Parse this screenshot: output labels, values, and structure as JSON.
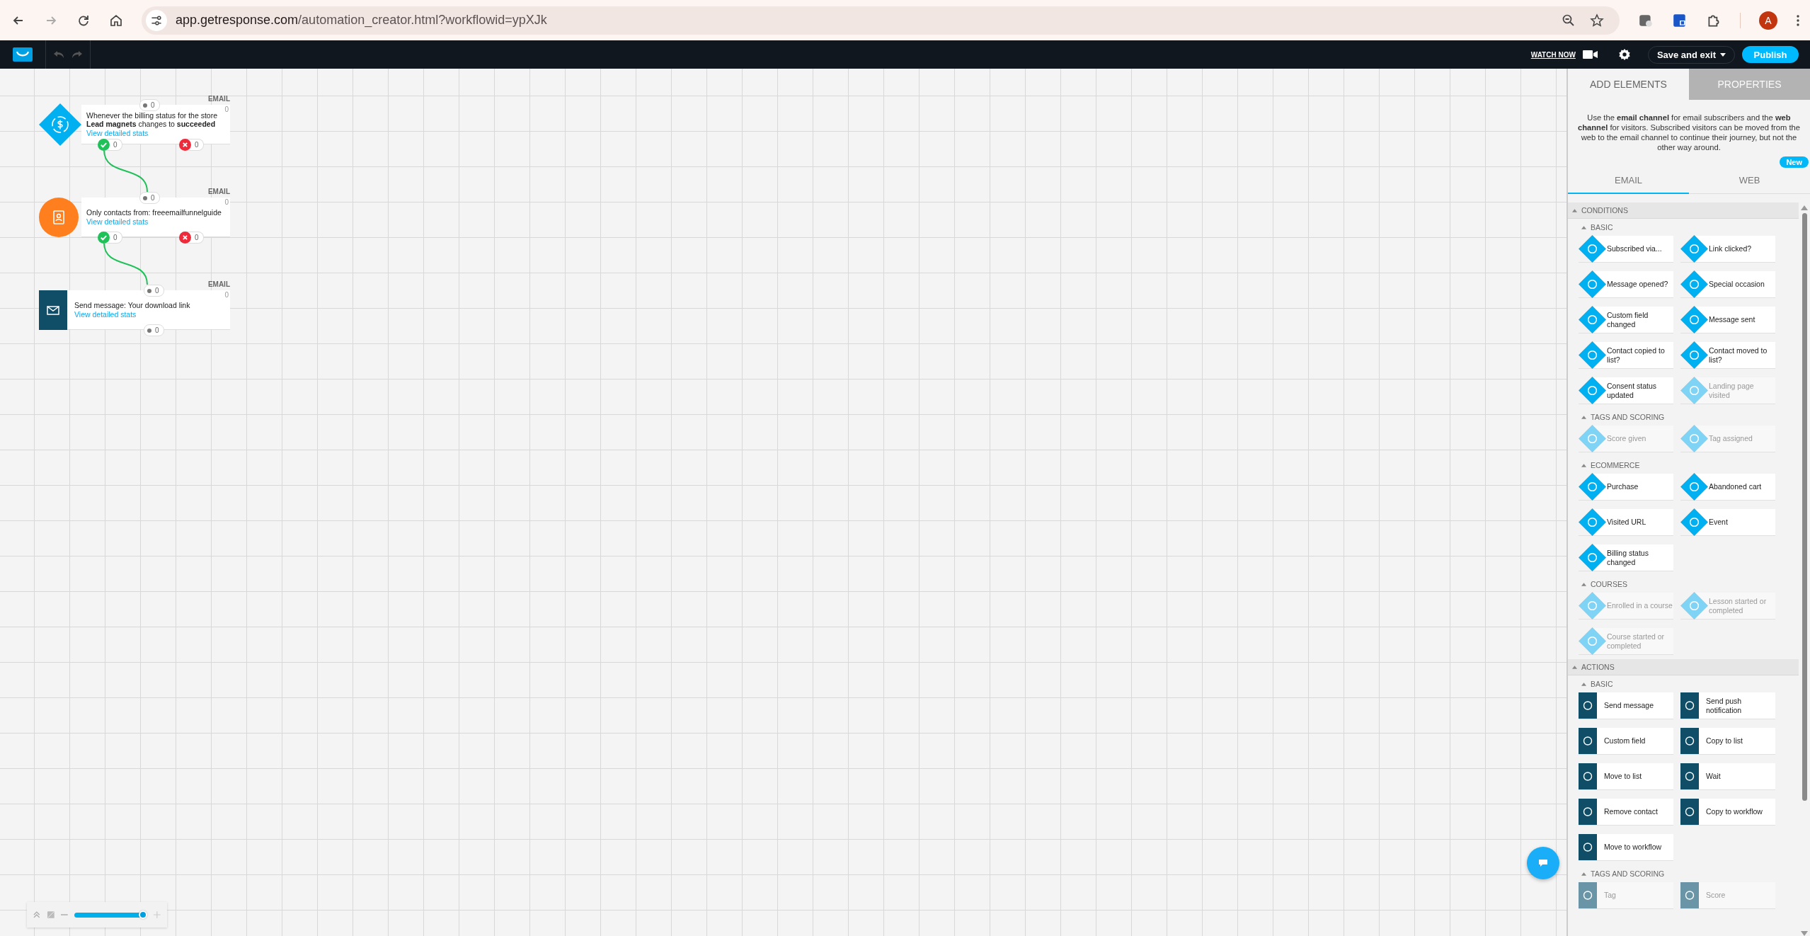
{
  "browser": {
    "url_host": "app.getresponse.com",
    "url_path": "/automation_creator.html?workflowid=ypXJk",
    "avatar": "A"
  },
  "toolbar": {
    "watch_now": "WATCH NOW",
    "save": "Save and exit",
    "publish": "Publish"
  },
  "nodes": [
    {
      "kind": "trigger",
      "channel": "EMAIL",
      "count": "0",
      "label": "Whenever the billing status for the store **Lead magnets** changes to **succeeded**",
      "link": "View detailed stats",
      "ports": [
        {
          "kind": "in",
          "count": "0"
        },
        {
          "kind": "yes",
          "count": "0"
        },
        {
          "kind": "no",
          "count": "0"
        }
      ]
    },
    {
      "kind": "filter",
      "channel": "EMAIL",
      "count": "0",
      "label": "Only contacts from: freeemailfunnelguide",
      "link": "View detailed stats",
      "ports": [
        {
          "kind": "in",
          "count": "0"
        },
        {
          "kind": "yes",
          "count": "0"
        },
        {
          "kind": "no",
          "count": "0"
        }
      ]
    },
    {
      "kind": "action",
      "channel": "EMAIL",
      "count": "0",
      "label": "Send message: Your download link",
      "link": "View detailed stats",
      "ports": [
        {
          "kind": "in",
          "count": "0"
        },
        {
          "kind": "out",
          "count": "0"
        }
      ]
    }
  ],
  "zoom": {
    "level": 1
  },
  "panel": {
    "tabs": [
      {
        "label": "ADD ELEMENTS",
        "selected": true
      },
      {
        "label": "PROPERTIES",
        "selected": false
      }
    ],
    "info": "Use the **email channel** for email subscribers and the **web channel** for visitors. Subscribed visitors can be moved from the web to the email channel to continue their journey, but not the other way around.",
    "badge": "New",
    "channels": [
      {
        "label": "EMAIL",
        "selected": true
      },
      {
        "label": "WEB",
        "selected": false
      }
    ],
    "sections": [
      {
        "title": "CONDITIONS",
        "kind": "condition",
        "groups": [
          {
            "title": "BASIC",
            "items": [
              {
                "label": "Subscribed via...",
                "disabled": false
              },
              {
                "label": "Link clicked?",
                "disabled": false
              },
              {
                "label": "Message opened?",
                "disabled": false
              },
              {
                "label": "Special occasion",
                "disabled": false
              },
              {
                "label": "Custom field changed",
                "disabled": false
              },
              {
                "label": "Message sent",
                "disabled": false
              },
              {
                "label": "Contact copied to list?",
                "disabled": false
              },
              {
                "label": "Contact moved to list?",
                "disabled": false
              },
              {
                "label": "Consent status updated",
                "disabled": false
              },
              {
                "label": "Landing page visited",
                "disabled": true
              }
            ]
          },
          {
            "title": "TAGS AND SCORING",
            "items": [
              {
                "label": "Score given",
                "disabled": true
              },
              {
                "label": "Tag assigned",
                "disabled": true
              }
            ]
          },
          {
            "title": "ECOMMERCE",
            "items": [
              {
                "label": "Purchase",
                "disabled": false
              },
              {
                "label": "Abandoned cart",
                "disabled": false
              },
              {
                "label": "Visited URL",
                "disabled": false
              },
              {
                "label": "Event",
                "disabled": false
              },
              {
                "label": "Billing status changed",
                "disabled": false
              }
            ]
          },
          {
            "title": "COURSES",
            "items": [
              {
                "label": "Enrolled in a course",
                "disabled": true
              },
              {
                "label": "Lesson started or completed",
                "disabled": true
              },
              {
                "label": "Course started or completed",
                "disabled": true
              }
            ]
          }
        ]
      },
      {
        "title": "ACTIONS",
        "kind": "action",
        "groups": [
          {
            "title": "BASIC",
            "items": [
              {
                "label": "Send message",
                "disabled": false
              },
              {
                "label": "Send push notification",
                "disabled": false
              },
              {
                "label": "Custom field",
                "disabled": false
              },
              {
                "label": "Copy to list",
                "disabled": false
              },
              {
                "label": "Move to list",
                "disabled": false
              },
              {
                "label": "Wait",
                "disabled": false
              },
              {
                "label": "Remove contact",
                "disabled": false
              },
              {
                "label": "Copy to workflow",
                "disabled": false
              },
              {
                "label": "Move to workflow",
                "disabled": false
              }
            ]
          },
          {
            "title": "TAGS AND SCORING",
            "items": [
              {
                "label": "Tag",
                "disabled": true
              },
              {
                "label": "Score",
                "disabled": true
              }
            ]
          }
        ]
      }
    ]
  }
}
